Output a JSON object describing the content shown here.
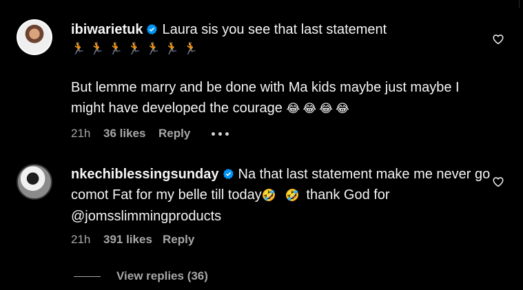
{
  "comments": [
    {
      "username": "ibiwarietuk",
      "text_line1": "Laura sis you see that last statement",
      "runners": "🏃🏃🏃🏃🏃🏃🏃",
      "text_part2": "But lemme marry and be done with Ma kids maybe just maybe I might have developed the courage",
      "emojis_end": "😂😂😂😂",
      "time": "21h",
      "likes": "36 likes",
      "reply": "Reply"
    },
    {
      "username": "nkechiblessingsunday",
      "text_part1": "Na that last statement make me never go comot Fat for my belle till today",
      "emojis_mid": "🤣 🤣",
      "text_part2": "thank God for @jomsslimmingproducts",
      "time": "21h",
      "likes": "391 likes",
      "reply": "Reply"
    }
  ],
  "view_replies": "View replies (36)",
  "icons": {
    "verified": "verified-badge-icon",
    "like": "heart-icon",
    "more": "more-options-icon"
  },
  "colors": {
    "background": "#000000",
    "text": "#f5f5f5",
    "muted": "#a8a8a8",
    "verified": "#0095f6"
  }
}
